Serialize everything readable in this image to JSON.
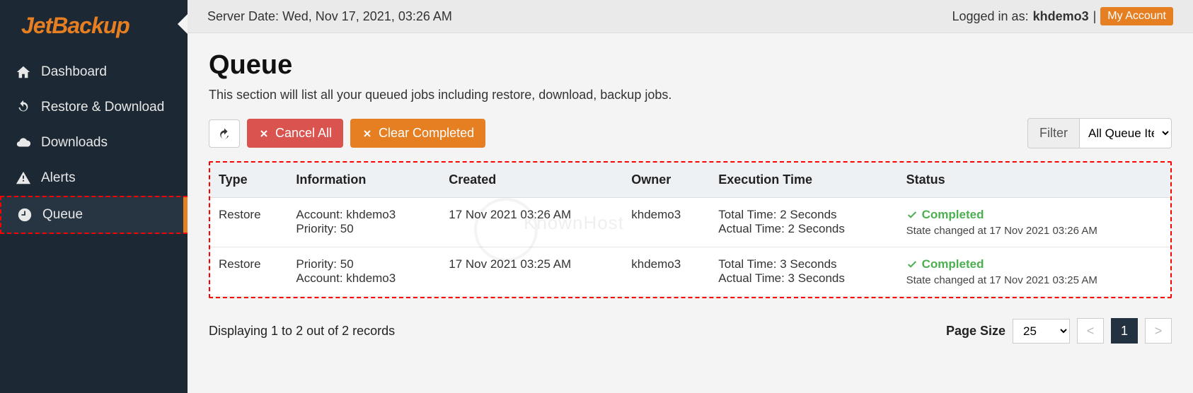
{
  "brand": "JetBackup",
  "topbar": {
    "server_date_label": "Server Date:",
    "server_date_value": "Wed, Nov 17, 2021, 03:26 AM",
    "logged_in_label": "Logged in as:",
    "logged_in_user": "khdemo3",
    "my_account": "My Account"
  },
  "sidebar": {
    "items": [
      {
        "label": "Dashboard",
        "icon": "home"
      },
      {
        "label": "Restore & Download",
        "icon": "refresh"
      },
      {
        "label": "Downloads",
        "icon": "cloud"
      },
      {
        "label": "Alerts",
        "icon": "alert"
      },
      {
        "label": "Queue",
        "icon": "clock",
        "active": true
      }
    ]
  },
  "page": {
    "title": "Queue",
    "description": "This section will list all your queued jobs including restore, download, backup jobs."
  },
  "toolbar": {
    "cancel_all": "Cancel All",
    "clear_completed": "Clear Completed",
    "filter": "Filter",
    "filter_select": "All Queue Items"
  },
  "table": {
    "headers": [
      "Type",
      "Information",
      "Created",
      "Owner",
      "Execution Time",
      "Status"
    ],
    "rows": [
      {
        "type": "Restore",
        "info_line1": "Account: khdemo3",
        "info_line2": "Priority: 50",
        "created": "17 Nov 2021 03:26 AM",
        "owner": "khdemo3",
        "exec_line1": "Total Time: 2 Seconds",
        "exec_line2": "Actual Time: 2 Seconds",
        "status": "Completed",
        "status_note": "State changed at 17 Nov 2021 03:26 AM"
      },
      {
        "type": "Restore",
        "info_line1": "Priority: 50",
        "info_line2": "Account: khdemo3",
        "created": "17 Nov 2021 03:25 AM",
        "owner": "khdemo3",
        "exec_line1": "Total Time: 3 Seconds",
        "exec_line2": "Actual Time: 3 Seconds",
        "status": "Completed",
        "status_note": "State changed at 17 Nov 2021 03:25 AM"
      }
    ]
  },
  "footer": {
    "summary": "Displaying 1 to 2 out of 2 records",
    "page_size_label": "Page Size",
    "page_size_value": "25",
    "current_page": "1"
  },
  "watermark": "KnownHost"
}
